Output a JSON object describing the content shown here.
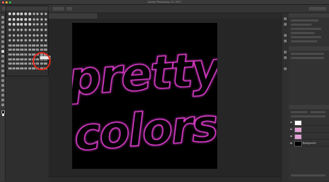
{
  "window": {
    "title": "Adobe Photoshop CC 2017"
  },
  "document": {
    "tab_label": ""
  },
  "artwork": {
    "text_line1": "pretty",
    "text_line2": "colors",
    "glow_color": "#d43ac4",
    "fill_color": "#000000",
    "canvas_color": "#000000"
  },
  "layers": {
    "items": [
      {
        "name": "",
        "thumb_color": "#ffffff"
      },
      {
        "name": "",
        "thumb_color": "#e6a0d8"
      },
      {
        "name": "",
        "thumb_color": "#e6a0d8"
      },
      {
        "name": "Background",
        "thumb_color": "#000000"
      }
    ]
  },
  "annotation": {
    "color": "#e0281d"
  },
  "icons": [
    "brush-icon",
    "eye-icon",
    "close-icon",
    "layers-icon"
  ]
}
